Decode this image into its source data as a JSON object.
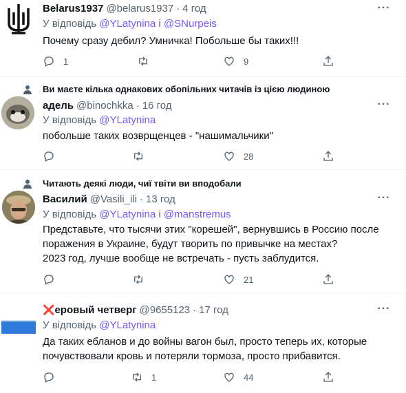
{
  "common": {
    "replying_prefix": "У відповідь",
    "and_word": "і",
    "dot": "·",
    "more": "···"
  },
  "tweets": [
    {
      "name": "Belarus1937",
      "handle": "@belarus1937",
      "time": "4 год",
      "reply_to": [
        "@YLatynina",
        "@SNurpeis"
      ],
      "text": "Почему сразу дебил? Умничка! Побольше бы таких!!!",
      "replies": "1",
      "retweets": "",
      "likes": "9",
      "avatar": "trident-emblem"
    },
    {
      "context": "Ви маєте кілька однакових обопільних читачів із цією людиною",
      "name": "адель",
      "handle": "@binochkka",
      "time": "16 год",
      "reply_to": [
        "@YLatynina"
      ],
      "text": "побольше таких возврщенцев - \"нашимальчики\"",
      "replies": "",
      "retweets": "",
      "likes": "28",
      "avatar": "seal-photo"
    },
    {
      "context": "Читають деякі люди, чиї твіти ви вподобали",
      "name": "Василий",
      "handle": "@Vasili_ili",
      "time": "13 год",
      "reply_to": [
        "@YLatynina",
        "@manstremus"
      ],
      "text_lines": [
        "Представьте, что тысячи этих \"корешей\", вернувшись в Россию после",
        "поражения в Украине, будут творить по привычке на местах?",
        "2023 год, лучше вообще не встречать - пусть заблудится."
      ],
      "replies": "",
      "retweets": "",
      "likes": "21",
      "avatar": "man-photo"
    },
    {
      "name_mark": "❌",
      "name": "еровый четверг",
      "handle": "@9655123",
      "time": "17 год",
      "reply_to": [
        "@YLatynina"
      ],
      "text_lines": [
        "Да таких ебланов и до войны вагон был, просто теперь их, которые",
        "почувствовали кровь и потеряли тормоза, просто прибавится."
      ],
      "replies": "",
      "retweets": "1",
      "likes": "44",
      "avatar": "blue-flag"
    }
  ],
  "colors": {
    "link": "#7856ff",
    "secondary": "#536471",
    "text": "#0f1419"
  }
}
